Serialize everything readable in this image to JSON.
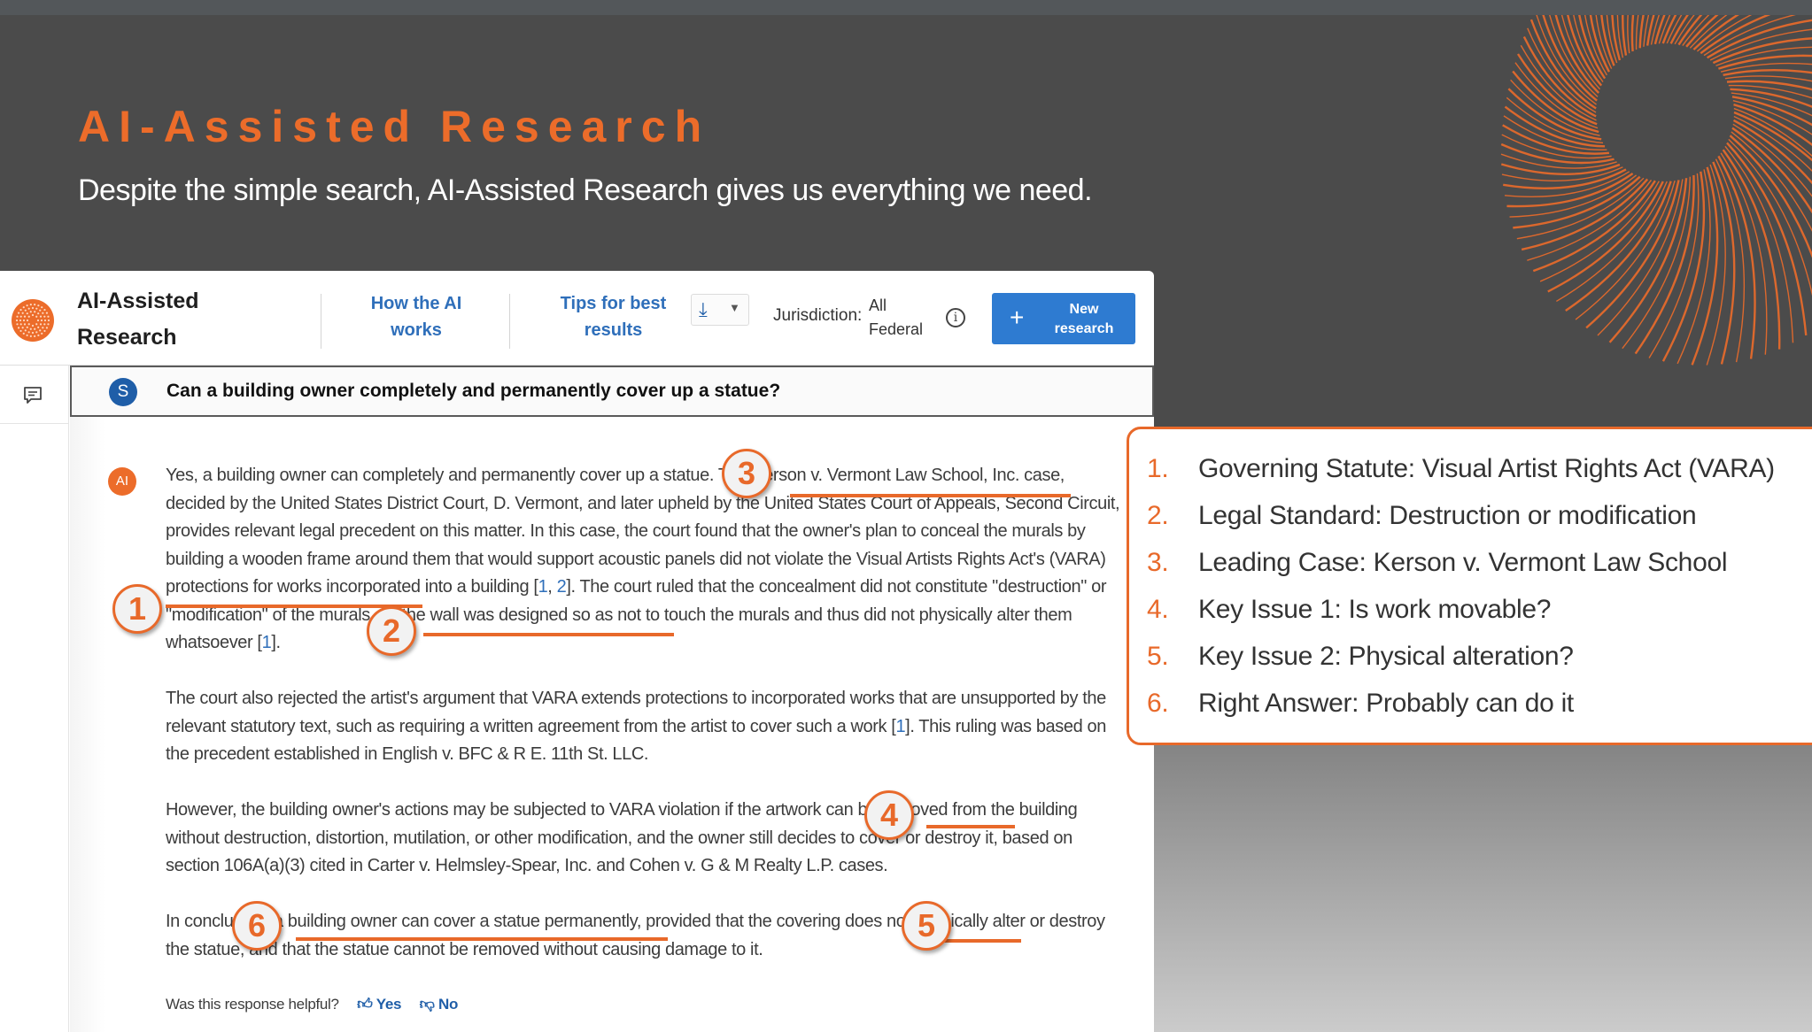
{
  "slide": {
    "title": "AI-Assisted Research",
    "subtitle": "Despite the simple search, AI-Assisted Research gives us everything we need.",
    "accent_color": "#ec6c2a"
  },
  "app": {
    "name_line1": "AI-Assisted",
    "name_line2": "Research",
    "nav": {
      "how_ai_works_line1": "How the AI",
      "how_ai_works_line2": "works",
      "tips_line1": "Tips for best",
      "tips_line2": "results"
    },
    "download_icon": "download-icon",
    "jurisdiction_label": "Jurisdiction:",
    "jurisdiction_value_line1": "All",
    "jurisdiction_value_line2": "Federal",
    "info_glyph": "i",
    "new_research_plus": "+",
    "new_research_line1": "New",
    "new_research_line2": "research",
    "primary_color": "#2e7bd1"
  },
  "question": {
    "avatar_initial": "S",
    "text": "Can a building owner completely and permanently cover up a statue?"
  },
  "answer": {
    "badge": "AI",
    "p1": {
      "a": "Yes, a building owner can completely and permanently cover up a statue. The ",
      "case": "Kerson v. Vermont Law School, Inc.",
      "b": " case, decided by the United States District Court, D. Vermont, and later upheld by the United States Court of Appeals, Second Circuit, provides relevant legal precedent on this matter. In this case, the court found that the owner's plan to conceal the murals by building a wooden frame around them that would support acoustic panels did not violate the ",
      "statute": "Visual Artists Rights Act's (VARA)",
      "c": " protections for works incorporated into a building [",
      "cite1": "1",
      "comma": ", ",
      "cite2": "2",
      "d": "]. The court ruled that the concealment did not constitute ",
      "standard": "\"destruction\" or \"modification\"",
      "e": " of the murals, as the wall was designed so as not to touch the murals and thus did not physically alter them whatsoever [",
      "cite3": "1",
      "f": "]."
    },
    "p2": {
      "a": "The court also rejected the artist's argument that VARA extends protections to incorporated works that are unsupported by the relevant statutory text, such as requiring a written agreement from the artist to cover such a work [",
      "cite": "1",
      "b": "]. This ruling was based on the precedent established in English v. BFC & R E. 11th St. LLC."
    },
    "p3": {
      "a": "However, the building owner's actions may be subjected to VARA violation if the artwork can be ",
      "removed": "removed",
      "b": " from the building without destruction, distortion, mutilation, or other modification, and the owner still decides to cover or destroy it, based on section 106A(a)(3) cited in Carter v. Helmsley-Spear, Inc. and Cohen v. G & M Realty L.P. cases."
    },
    "p4": {
      "a": "In conclusion, a ",
      "conclusion": "building owner can cover a statue permanently",
      "b": ", provided that the covering does not ",
      "alter": "physically alter",
      "c": " or destroy the statue, and that the statue cannot be removed without causing damage to it."
    },
    "feedback_prompt": "Was this response helpful?",
    "yes_label": "Yes",
    "no_label": "No"
  },
  "annotations": [
    "1",
    "2",
    "3",
    "4",
    "5",
    "6"
  ],
  "callout": {
    "items": [
      {
        "num": "1.",
        "text": "Governing Statute: Visual Artist Rights Act (VARA)"
      },
      {
        "num": "2.",
        "text": "Legal Standard: Destruction or modification"
      },
      {
        "num": "3.",
        "text": "Leading Case: Kerson v. Vermont Law School"
      },
      {
        "num": "4.",
        "text": "Key Issue 1: Is work movable?"
      },
      {
        "num": "5.",
        "text": "Key Issue 2: Physical alteration?"
      },
      {
        "num": "6.",
        "text": "Right Answer: Probably can do it"
      }
    ]
  }
}
